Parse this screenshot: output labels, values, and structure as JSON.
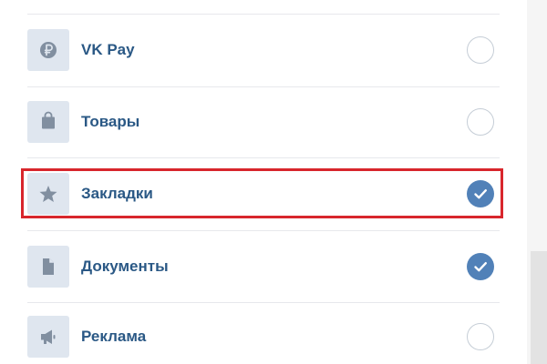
{
  "menu": {
    "items": [
      {
        "label": "VK Pay",
        "icon": "ruble-coin-icon",
        "checked": false
      },
      {
        "label": "Товары",
        "icon": "shopping-bag-icon",
        "checked": false
      },
      {
        "label": "Закладки",
        "icon": "star-icon",
        "checked": true,
        "highlighted": true
      },
      {
        "label": "Документы",
        "icon": "document-icon",
        "checked": true
      },
      {
        "label": "Реклама",
        "icon": "megaphone-icon",
        "checked": false
      }
    ]
  },
  "colors": {
    "label": "#2a5885",
    "icon": "#818fa0",
    "icon_tile": "#dfe6ef",
    "check_on": "#5181b8",
    "check_off_border": "#c5cdd6",
    "highlight_frame": "#d8262c"
  }
}
